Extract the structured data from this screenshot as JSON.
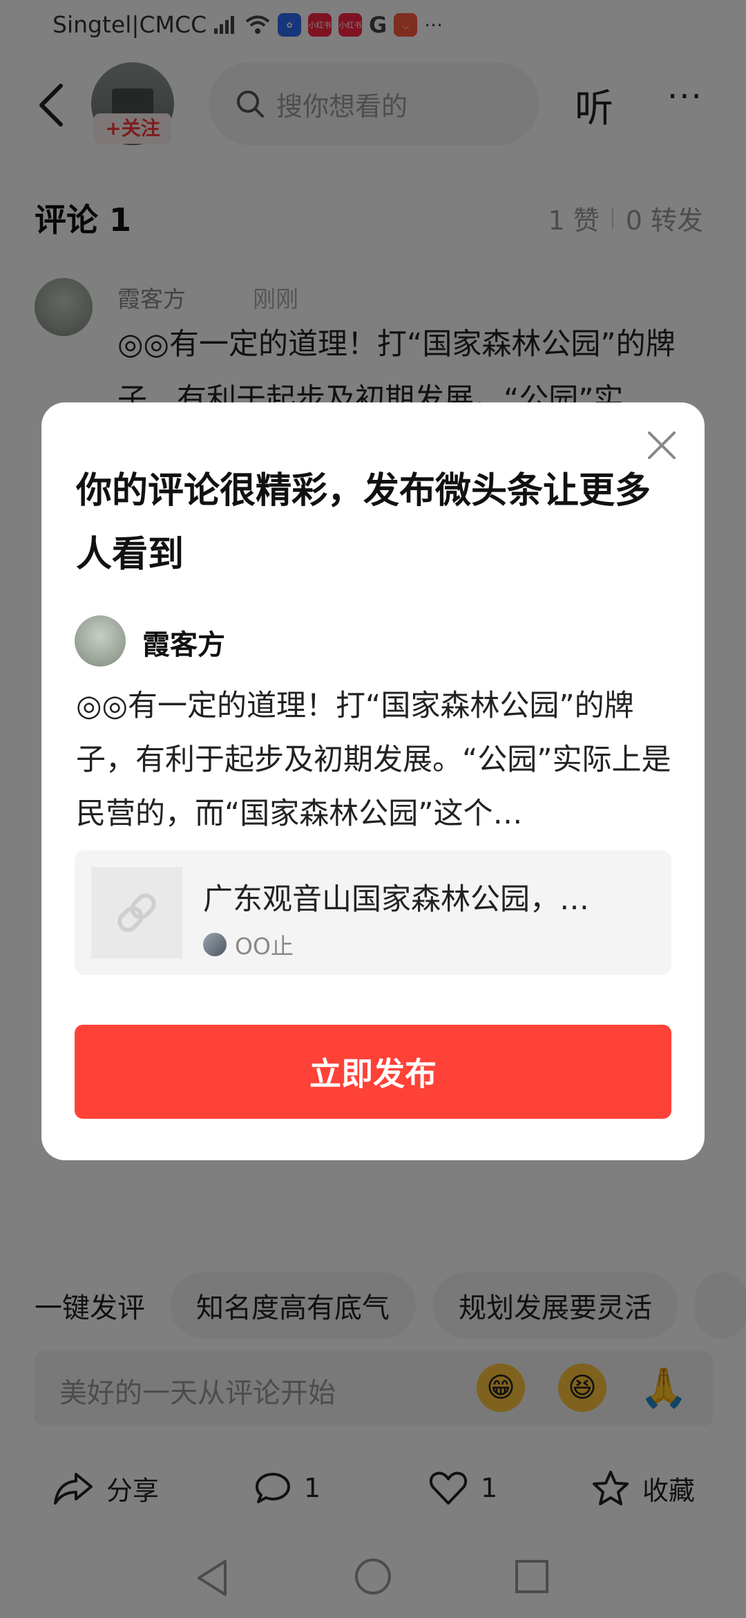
{
  "status_bar": {
    "carrier": "Singtel|CMCC",
    "badges": [
      "小红书",
      "小红书"
    ],
    "google": "G",
    "more": "···"
  },
  "header": {
    "follow_label": "+关注",
    "search_placeholder": "搜你想看的",
    "listen_label": "听",
    "more_label": "···"
  },
  "comments": {
    "title": "评论 1",
    "likes": "1 赞",
    "reposts": "0 转发",
    "items": [
      {
        "author": "霞客方",
        "time": "刚刚",
        "text": "◎◎有一定的道理！打“国家森林公园”的牌子，有利于起步及初期发展。“公园”实"
      }
    ]
  },
  "quick_reply": {
    "label": "一键发评",
    "chips": [
      "知名度高有底气",
      "规划发展要灵活"
    ]
  },
  "input": {
    "placeholder": "美好的一天从评论开始",
    "emojis": [
      "😁",
      "😆",
      "🙏"
    ]
  },
  "actions": {
    "share": "分享",
    "comment_count": "1",
    "like_count": "1",
    "favorite": "收藏"
  },
  "dialog": {
    "title": "你的评论很精彩，发布微头条让更多人看到",
    "author": "霞客方",
    "body": "◎◎有一定的道理！打“国家森林公园”的牌子，有利于起步及初期发展。“公园”实际上是民营的，而“国家森林公园”这个…",
    "link_title": "广东观音山国家森林公园，…",
    "link_author": "OO止",
    "publish_label": "立即发布"
  }
}
